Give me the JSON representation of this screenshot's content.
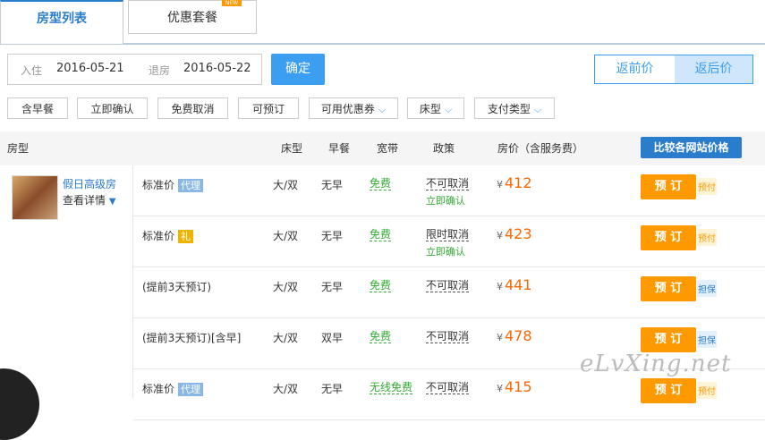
{
  "tabs": [
    {
      "label": "房型列表",
      "active": true
    },
    {
      "label": "优惠套餐",
      "active": false,
      "badge": "NEW"
    }
  ],
  "dates": {
    "checkin_label": "入住",
    "checkin_value": "2016-05-21",
    "checkout_label": "退房",
    "checkout_value": "2016-05-22",
    "confirm_label": "确定"
  },
  "price_toggle": {
    "before": "返前价",
    "after": "返后价"
  },
  "filters": {
    "breakfast": "含早餐",
    "instant": "立即确认",
    "free_cancel": "免费取消",
    "bookable": "可预订",
    "coupon": "可用优惠券",
    "bed": "床型",
    "payment": "支付类型"
  },
  "header": {
    "room": "房型",
    "bed": "床型",
    "breakfast": "早餐",
    "broadband": "宽带",
    "policy": "政策",
    "price": "房价（含服务费）",
    "compare": "比较各网站价格"
  },
  "room": {
    "name": "假日高级房",
    "view": "查看详情"
  },
  "rows": [
    {
      "rate": "标准价",
      "tag": "代理",
      "tag_color": "#8ab8e6",
      "bed": "大/双",
      "breakfast": "无早",
      "broadband": "免费",
      "policy": "不可取消",
      "policy2": "立即确认",
      "currency": "¥",
      "price": "412",
      "book": "预 订",
      "pay": "预付",
      "pay_color": "#f90",
      "pay_bg": "#fff3d6"
    },
    {
      "rate": "标准价",
      "tag": "礼",
      "tag_color": "#f0b400",
      "bed": "大/双",
      "breakfast": "无早",
      "broadband": "免费",
      "policy": "限时取消",
      "policy2": "立即确认",
      "currency": "¥",
      "price": "423",
      "book": "预 订",
      "pay": "预付",
      "pay_color": "#f90",
      "pay_bg": "#fff3d6"
    },
    {
      "rate": "(提前3天预订)",
      "tag": "",
      "tag_color": "",
      "bed": "大/双",
      "breakfast": "无早",
      "broadband": "免费",
      "policy": "不可取消",
      "policy2": "",
      "currency": "¥",
      "price": "441",
      "book": "预 订",
      "pay": "担保",
      "pay_color": "#2a7ccd",
      "pay_bg": "#e4f0fb"
    },
    {
      "rate": "(提前3天预订)[含早]",
      "tag": "",
      "tag_color": "",
      "bed": "大/双",
      "breakfast": "双早",
      "broadband": "免费",
      "policy": "不可取消",
      "policy2": "",
      "currency": "¥",
      "price": "478",
      "book": "预 订",
      "pay": "担保",
      "pay_color": "#2a7ccd",
      "pay_bg": "#e4f0fb"
    },
    {
      "rate": "标准价",
      "tag": "代理",
      "tag_color": "#8ab8e6",
      "bed": "大/双",
      "breakfast": "无早",
      "broadband": "无线免费",
      "policy": "不可取消",
      "policy2": "",
      "currency": "¥",
      "price": "415",
      "book": "预 订",
      "pay": "预付",
      "pay_color": "#f90",
      "pay_bg": "#fff3d6"
    }
  ],
  "watermark": "eLvXing.net"
}
